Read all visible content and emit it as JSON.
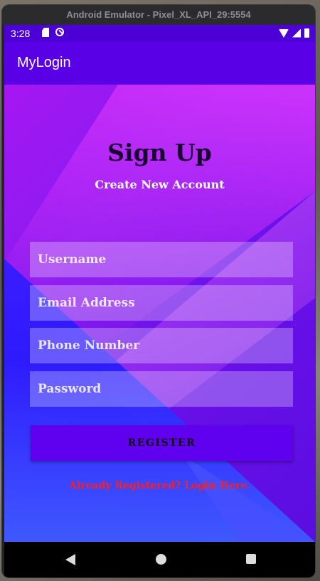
{
  "window": {
    "title": "Android Emulator - Pixel_XL_API_29:5554"
  },
  "status_bar": {
    "time": "3:28"
  },
  "app_bar": {
    "title": "MyLogin"
  },
  "form": {
    "title": "Sign Up",
    "subtitle": "Create New Account",
    "username_placeholder": "Username",
    "email_placeholder": "Email Address",
    "phone_placeholder": "Phone Number",
    "password_placeholder": "Password",
    "register_label": "REGISTER",
    "login_link": "Already Registered? Login Here."
  },
  "icons": {
    "status": [
      "sd-card-icon",
      "sync-icon",
      "wifi-icon",
      "signal-icon",
      "battery-icon"
    ],
    "nav": [
      "back-icon",
      "home-icon",
      "recents-icon"
    ]
  },
  "colors": {
    "app_bar": "#5a00e6",
    "status_bar": "#4c00d6",
    "register_button": "#5f00ee",
    "login_link": "#ff1e1e"
  }
}
